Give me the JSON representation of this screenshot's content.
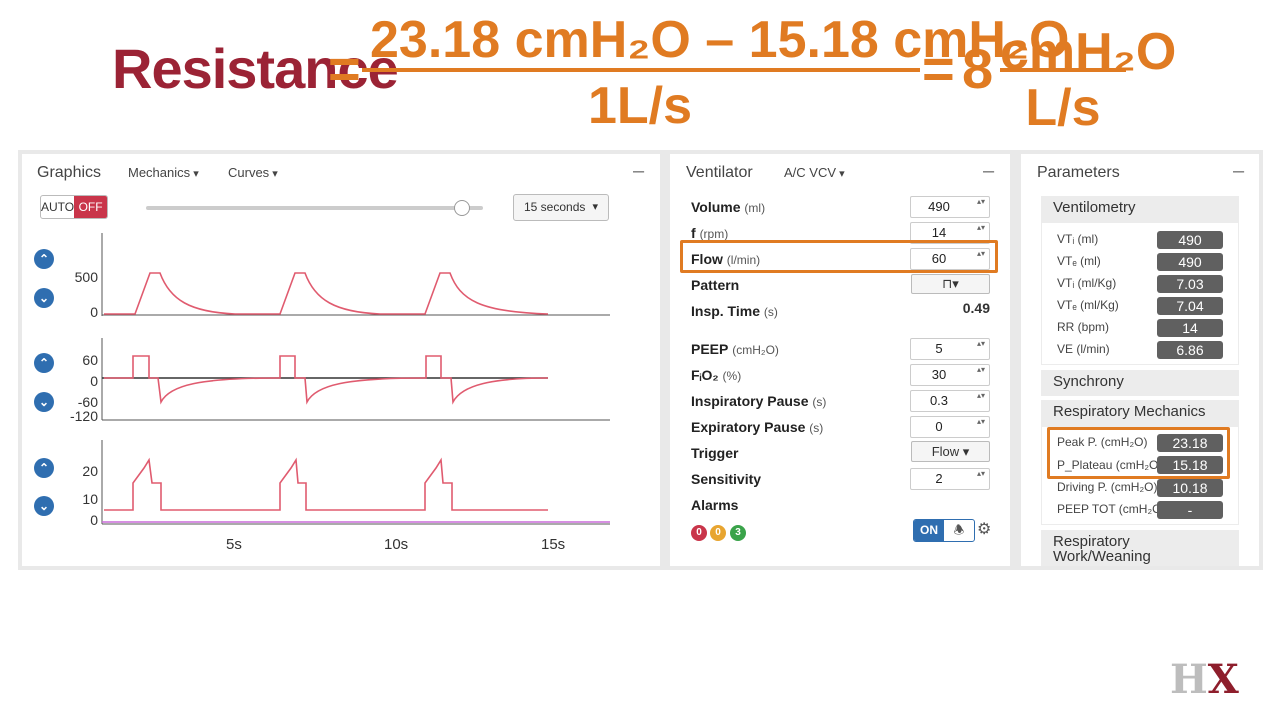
{
  "formula": {
    "label": "Resistance",
    "eq1": "=",
    "numerator": "23.18 cmH₂O – 15.18 cmH₂O",
    "denominator": "1L/s",
    "eq2": "=",
    "result": "8",
    "result_unit_top": "cmH₂O",
    "result_unit_bottom": "L/s"
  },
  "graphics": {
    "title": "Graphics",
    "menu_mechanics": "Mechanics",
    "menu_curves": "Curves",
    "minimize": "–",
    "auto_label": "AUTO",
    "off_label": "OFF",
    "time_window": "15 seconds",
    "volume_ticks": [
      "500",
      "0"
    ],
    "flow_ticks": [
      "60",
      "0",
      "-60",
      "-120"
    ],
    "pressure_ticks": [
      "20",
      "10",
      "0"
    ],
    "x_ticks": [
      "5s",
      "10s",
      "15s"
    ],
    "up_icon": "chevron-up-icon",
    "down_icon": "chevron-down-icon",
    "wave_color": "#e05b6f"
  },
  "ventilator": {
    "title": "Ventilator",
    "mode": "A/C VCV",
    "minimize": "–",
    "fields": [
      {
        "name": "Volume",
        "unit": "(ml)",
        "value": "490"
      },
      {
        "name": "f",
        "unit": "(rpm)",
        "value": "14"
      },
      {
        "name": "Flow",
        "unit": "(l/min)",
        "value": "60"
      }
    ],
    "pattern_label": "Pattern",
    "pattern_value": "⊓▾",
    "insp_time_label": "Insp. Time",
    "insp_time_unit": "(s)",
    "insp_time_value": "0.49",
    "fields2": [
      {
        "name": "PEEP",
        "unit": "(cmH₂O)",
        "value": "5"
      },
      {
        "name": "FᵢO₂",
        "unit": "(%)",
        "value": "30"
      },
      {
        "name": "Inspiratory Pause",
        "unit": "(s)",
        "value": "0.3"
      },
      {
        "name": "Expiratory Pause",
        "unit": "(s)",
        "value": "0"
      }
    ],
    "trigger_label": "Trigger",
    "trigger_value": "Flow",
    "sensitivity_label": "Sensitivity",
    "sensitivity_value": "2",
    "alarms_label": "Alarms",
    "alarm_counts": [
      "0",
      "0",
      "3"
    ],
    "alarm_colors": [
      "#c9354a",
      "#e8a530",
      "#3aa34a"
    ],
    "on_label": "ON",
    "bell_icon": "bell-icon",
    "gear_icon": "gear-icon",
    "highlight_color": "#e07b22"
  },
  "parameters": {
    "title": "Parameters",
    "minimize": "–",
    "ventilometry_title": "Ventilometry",
    "ventilometry": [
      {
        "label": "VTᵢ (ml)",
        "value": "490"
      },
      {
        "label": "VTₑ (ml)",
        "value": "490"
      },
      {
        "label": "VTᵢ (ml/Kg)",
        "value": "7.03"
      },
      {
        "label": "VTₑ (ml/Kg)",
        "value": "7.04"
      },
      {
        "label": "RR (bpm)",
        "value": "14"
      },
      {
        "label": "VE (l/min)",
        "value": "6.86"
      }
    ],
    "synchrony_title": "Synchrony",
    "mechanics_title": "Respiratory Mechanics",
    "mechanics": [
      {
        "label": "Peak P. (cmH₂O)",
        "value": "23.18"
      },
      {
        "label": "P_Plateau (cmH₂O)",
        "value": "15.18"
      },
      {
        "label": "Driving P. (cmH₂O)",
        "value": "10.18"
      },
      {
        "label": "PEEP TOT (cmH₂O)",
        "value": "-"
      }
    ],
    "work_title_line1": "Respiratory",
    "work_title_line2": "Work/Weaning"
  },
  "logo": {
    "h": "H",
    "x": "X"
  }
}
